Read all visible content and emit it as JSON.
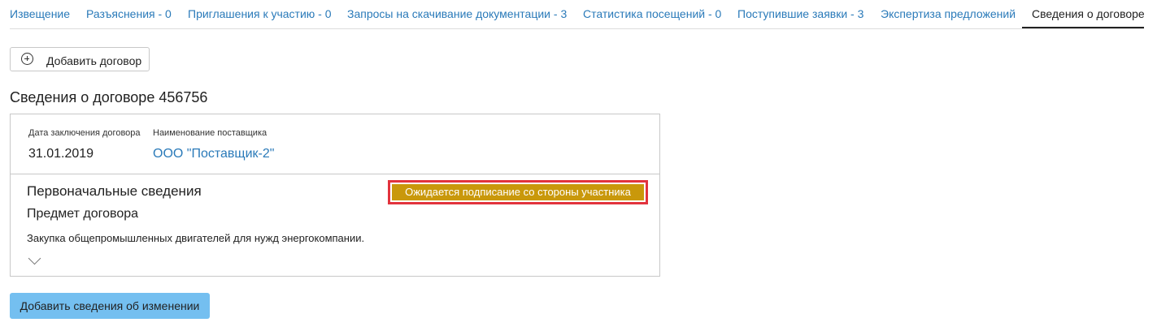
{
  "tabs": [
    {
      "label": "Извещение"
    },
    {
      "label": "Разъяснения - 0"
    },
    {
      "label": "Приглашения к участию - 0"
    },
    {
      "label": "Запросы на скачивание документации - 3"
    },
    {
      "label": "Статистика посещений - 0"
    },
    {
      "label": "Поступившие заявки - 3"
    },
    {
      "label": "Экспертиза предложений"
    },
    {
      "label": "Сведения о договоре"
    }
  ],
  "active_tab_index": 7,
  "actions": {
    "add_contract_label": "Добавить договор",
    "add_change_label": "Добавить сведения об изменении"
  },
  "contract": {
    "title": "Сведения о договоре 456756",
    "date_label": "Дата заключения договора",
    "date_value": "31.01.2019",
    "supplier_label": "Наименование поставщика",
    "supplier_value": "ООО \"Поставщик-2\"",
    "initial_title": "Первоначальные сведения",
    "status": "Ожидается подписание со стороны участника",
    "subject_title": "Предмет договора",
    "subject_text": "Закупка общепромышленных двигателей для нужд энергокомпании."
  },
  "icons": {
    "add": "plus-circle-icon",
    "expand": "chevron-down-icon"
  },
  "colors": {
    "link": "#2a7ab9",
    "status_bg": "#c9980b",
    "highlight_border": "#e2333d",
    "primary_button": "#74bff0"
  }
}
